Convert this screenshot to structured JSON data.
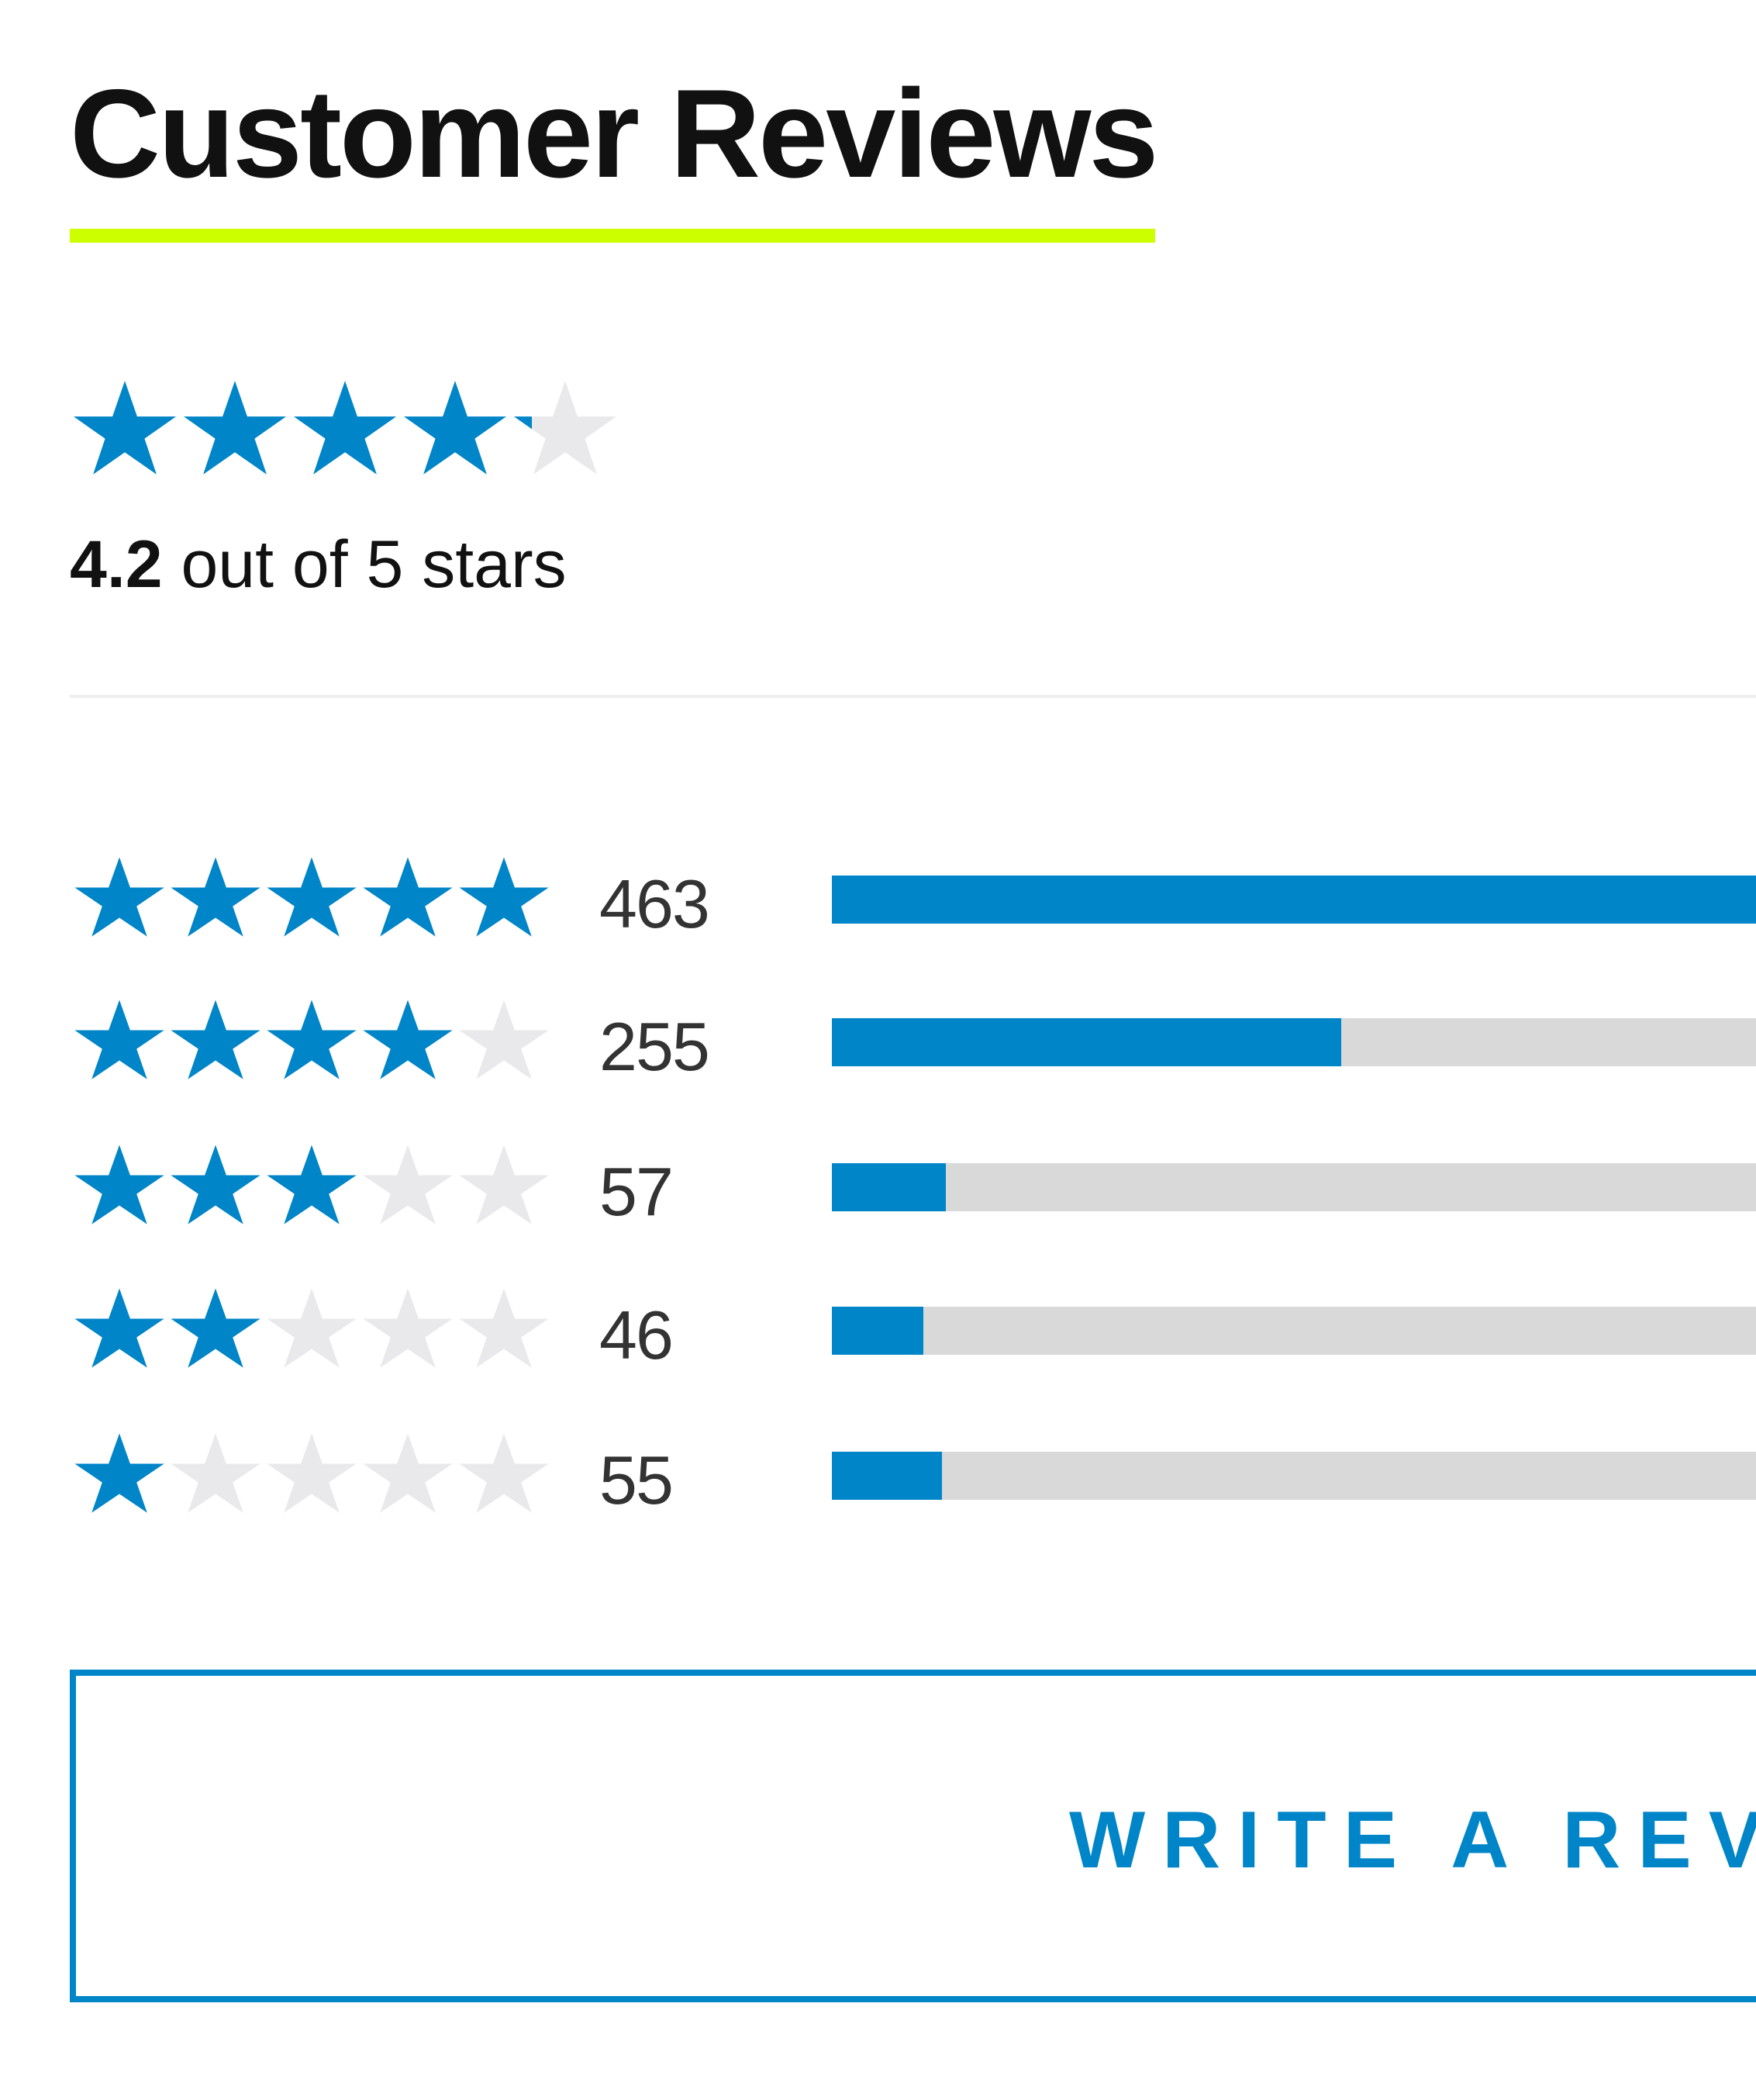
{
  "header": {
    "title": "Customer Reviews"
  },
  "summary": {
    "average_rating": 4.2,
    "rating_value": "4.2",
    "rating_suffix": "out of 5 stars",
    "max_stars": 5
  },
  "distribution": [
    {
      "stars": 5,
      "count": "463",
      "fraction": 1.0
    },
    {
      "stars": 4,
      "count": "255",
      "fraction": 0.551
    },
    {
      "stars": 3,
      "count": "57",
      "fraction": 0.123
    },
    {
      "stars": 2,
      "count": "46",
      "fraction": 0.099
    },
    {
      "stars": 1,
      "count": "55",
      "fraction": 0.119
    }
  ],
  "actions": {
    "write_review_label": "WRITE A REVIEW"
  },
  "colors": {
    "star_filled": "#0085c8",
    "star_empty": "#e9e9ec",
    "bar_fill": "#0085c8",
    "bar_track": "#d9d9d9",
    "title_underline": "#ccff00",
    "button_accent": "#0085c8"
  },
  "icons": {
    "star": "star-icon"
  }
}
